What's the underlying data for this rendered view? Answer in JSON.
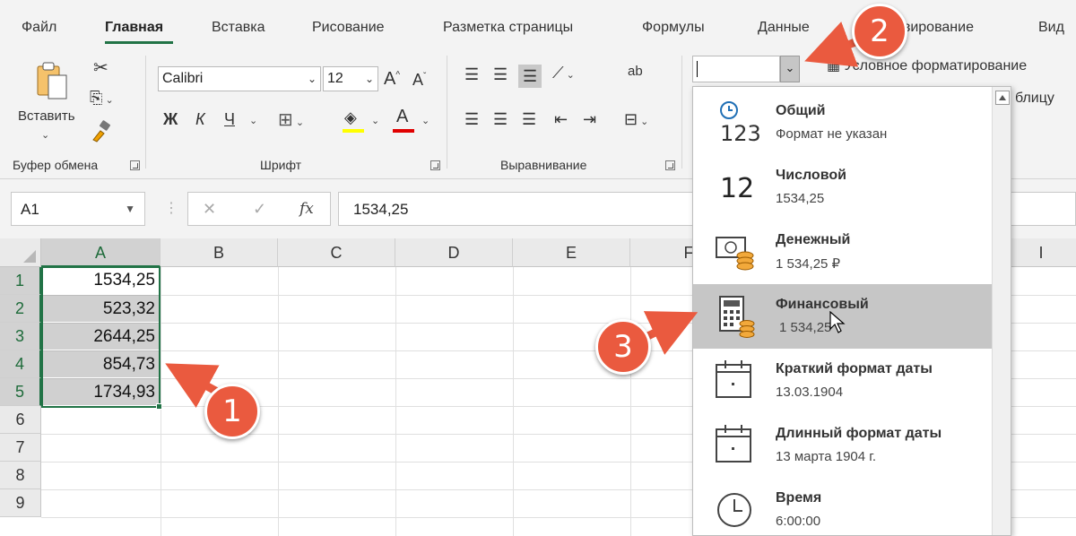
{
  "tabs": [
    "Файл",
    "Главная",
    "Вставка",
    "Рисование",
    "Разметка страницы",
    "Формулы",
    "Данные",
    "зирование",
    "Вид"
  ],
  "clipboard": {
    "paste_label": "Вставить",
    "group_label": "Буфер обмена"
  },
  "font": {
    "name": "Calibri",
    "size": "12",
    "bold": "Ж",
    "italic": "К",
    "underline": "Ч",
    "group_label": "Шрифт",
    "grow": "A",
    "shrink": "A"
  },
  "alignment": {
    "group_label": "Выравнивание",
    "wrap_glyph": "ab"
  },
  "number_format": {
    "value": ""
  },
  "styles": {
    "conditional_formatting": "Условное форматирование",
    "table_partial": "блицу"
  },
  "formula_bar": {
    "name_box": "A1",
    "fx": "fx",
    "value": "1534,25",
    "cancel": "✕",
    "enter": "✓"
  },
  "grid": {
    "columns": [
      "A",
      "B",
      "C",
      "D",
      "E",
      "F",
      "I"
    ],
    "rows": [
      "1",
      "2",
      "3",
      "4",
      "5",
      "6",
      "7",
      "8",
      "9"
    ],
    "values": [
      "1534,25",
      "523,32",
      "2644,25",
      "854,73",
      "1734,93"
    ]
  },
  "dropdown": {
    "items": [
      {
        "title": "Общий",
        "subtitle": "Формат не указан",
        "icon": "general-format-icon"
      },
      {
        "title": "Числовой",
        "subtitle": "1534,25",
        "icon": "number-format-icon",
        "glyph": "12"
      },
      {
        "title": "Денежный",
        "subtitle": "1 534,25 ₽",
        "icon": "currency-format-icon"
      },
      {
        "title": "Финансовый",
        "subtitle": "1 534,25",
        "icon": "accounting-format-icon",
        "highlighted": true
      },
      {
        "title": "Краткий формат даты",
        "subtitle": "13.03.1904",
        "icon": "short-date-icon"
      },
      {
        "title": "Длинный формат даты",
        "subtitle": "13 марта 1904 г.",
        "icon": "long-date-icon"
      },
      {
        "title": "Время",
        "subtitle": "6:00:00",
        "icon": "time-icon"
      }
    ],
    "general_glyph": "123"
  },
  "callouts": [
    "1",
    "2",
    "3"
  ],
  "colors": {
    "accent": "#217346",
    "callout": "#ea5a3f",
    "highlight": "#c6c6c6",
    "selection": "#d0d0d0"
  }
}
